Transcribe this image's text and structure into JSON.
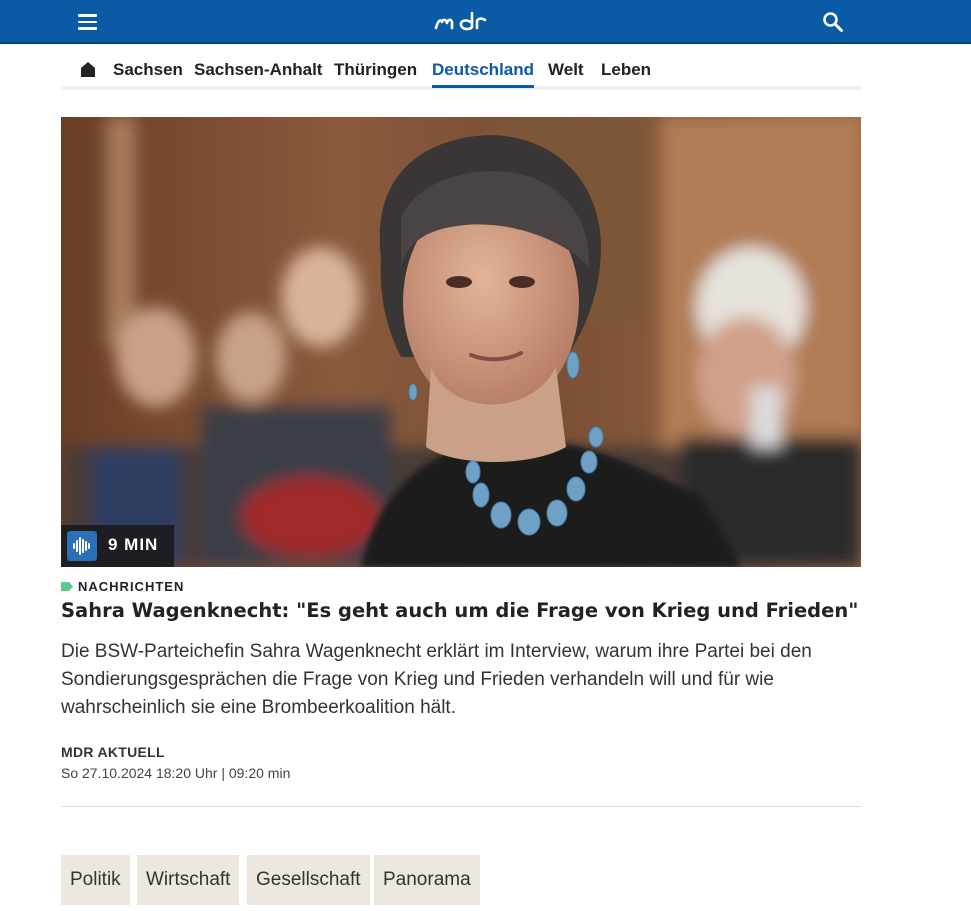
{
  "header": {
    "logo": "mdr",
    "menu_icon": "menu-icon",
    "search_icon": "search-icon",
    "brand_color": "#0b5aa6"
  },
  "nav": {
    "home_icon": "home-icon",
    "items": [
      {
        "label": "Sachsen"
      },
      {
        "label": "Sachsen-Anhalt"
      },
      {
        "label": "Thüringen"
      },
      {
        "label": "Deutschland",
        "active": true
      },
      {
        "label": "Welt"
      },
      {
        "label": "Leben"
      }
    ]
  },
  "article": {
    "audio_duration": "9 MIN",
    "audio_icon": "audio-wave-icon",
    "category": "NACHRICHTEN",
    "headline": "Sahra Wagenknecht: \"Es geht auch um die Frage von Krieg und Frieden\"",
    "teaser": "Die BSW-Parteichefin Sahra Wagenknecht erklärt im Interview, warum ihre Partei bei den Sondierungsgesprächen die Frage von Krieg und Frieden verhandeln will und für wie wahrscheinlich sie eine Brombeerkoalition hält.",
    "source": "MDR AKTUELL",
    "meta": "So 27.10.2024 18:20 Uhr | 09:20 min"
  },
  "chips": [
    "Politik",
    "Wirtschaft",
    "Gesellschaft",
    "Panorama"
  ]
}
